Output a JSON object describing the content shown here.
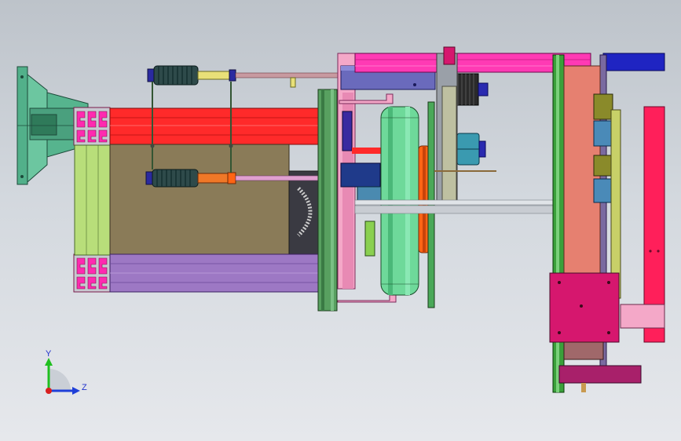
{
  "viewport": {
    "background_top": "#bdc3ca",
    "background_bottom": "#e6e8ec"
  },
  "triad": {
    "y_label": "Y",
    "z_label": "Z",
    "y_color": "#1fbf1f",
    "z_color": "#1f3fd8",
    "x_color": "#d81f1f"
  },
  "colors": {
    "base_plate": "#52b08a",
    "aluminum_profile": "#ff2a2a",
    "profile_slot": "#c8c8d0",
    "frame_green": "#b8de7a",
    "frame_olive": "#8a7b58",
    "purple_bar": "#9d78c4",
    "pink_bar": "#ff3ab4",
    "navy_block": "#1f24c2",
    "slate_block": "#6a6abc",
    "wheel_green": "#6ed99a",
    "flange_orange": "#ff6414",
    "salmon_panel": "#e68070",
    "magenta_block": "#d6176e",
    "red_column": "#ff1f5a",
    "cylinder_dark": "#2e4a4a",
    "cylinder_rod": "#e8e078",
    "teal_motor": "#3a9ab0"
  }
}
